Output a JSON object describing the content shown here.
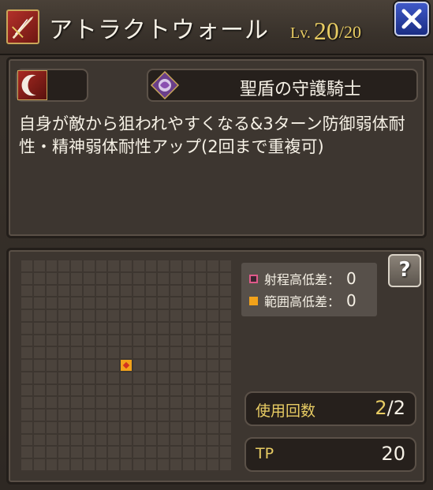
{
  "header": {
    "skill_icon": "sword-slash-icon",
    "title": "アトラクトウォール",
    "level_label": "Lv.",
    "level_current": "20",
    "level_max": "/20",
    "close_icon": "close-x-icon"
  },
  "skill": {
    "type_icon": "crescent-attack-icon",
    "job_icon": "holy-shield-knight-emblem-icon",
    "job_name": "聖盾の守護騎士",
    "description": "自身が敵から狙われやすくなる&3ターン防御弱体耐性・精神弱体耐性アップ(2回まで重複可)"
  },
  "range": {
    "grid_size": 17,
    "center_cell": [
      8,
      8
    ],
    "legend": [
      {
        "label": "射程高低差：",
        "value": "0",
        "color": "#e05a8a"
      },
      {
        "label": "範囲高低差：",
        "value": "0",
        "color": "#f2a21a"
      }
    ],
    "help_label": "?"
  },
  "stats": {
    "uses_label": "使用回数",
    "uses_current": "2",
    "uses_max": "/2",
    "tp_label": "TP",
    "tp_value": "20"
  },
  "colors": {
    "accent_gold": "#e8cc63",
    "range_highlight": "#f2a21a",
    "close_button": "#2a42a8"
  }
}
